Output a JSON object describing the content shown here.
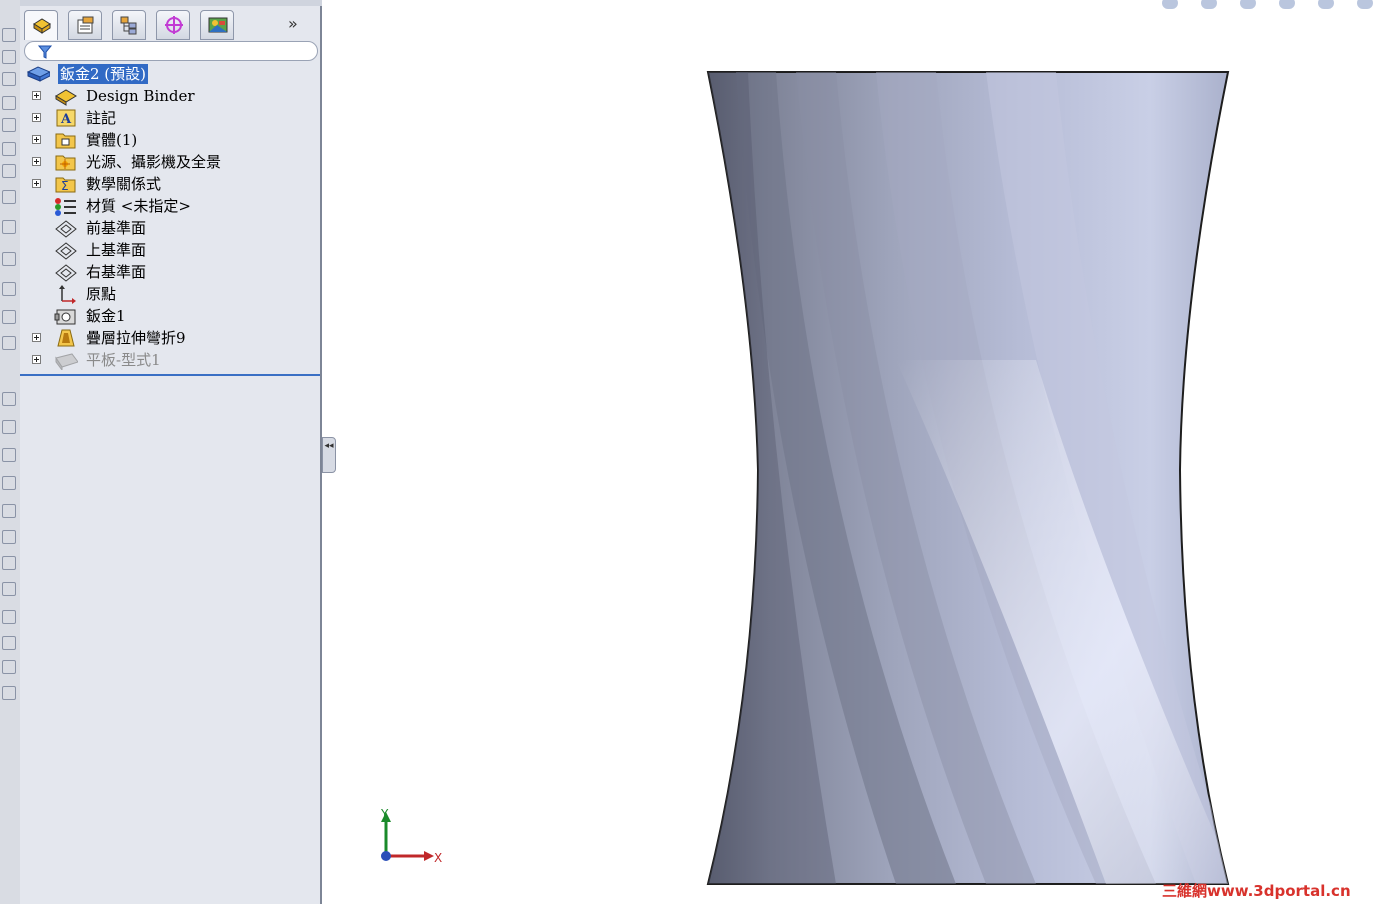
{
  "feature_tree": {
    "root_label": "鈑金2 (預設)",
    "items": [
      {
        "label": "Design Binder",
        "icon": "design-binder-icon",
        "expandable": true,
        "dim": false
      },
      {
        "label": "註記",
        "icon": "annotations-icon",
        "expandable": true,
        "dim": false
      },
      {
        "label": "實體(1)",
        "icon": "solid-bodies-icon",
        "expandable": true,
        "dim": false
      },
      {
        "label": "光源、攝影機及全景",
        "icon": "lights-cameras-icon",
        "expandable": true,
        "dim": false
      },
      {
        "label": "數學關係式",
        "icon": "equations-icon",
        "expandable": true,
        "dim": false
      },
      {
        "label": "材質 <未指定>",
        "icon": "material-icon",
        "expandable": false,
        "dim": false
      },
      {
        "label": "前基準面",
        "icon": "plane-icon",
        "expandable": false,
        "dim": false
      },
      {
        "label": "上基準面",
        "icon": "plane-icon",
        "expandable": false,
        "dim": false
      },
      {
        "label": "右基準面",
        "icon": "plane-icon",
        "expandable": false,
        "dim": false
      },
      {
        "label": "原點",
        "icon": "origin-icon",
        "expandable": false,
        "dim": false
      },
      {
        "label": "鈑金1",
        "icon": "sheet-metal-icon",
        "expandable": false,
        "dim": false
      },
      {
        "label": "疊層拉伸彎折9",
        "icon": "lofted-bend-icon",
        "expandable": true,
        "dim": false
      },
      {
        "label": "平板-型式1",
        "icon": "flat-pattern-icon",
        "expandable": true,
        "dim": true
      }
    ]
  },
  "panel_tabs": [
    {
      "name": "feature-manager-tab",
      "icon": "feature-manager-icon",
      "active": true
    },
    {
      "name": "property-manager-tab",
      "icon": "property-manager-icon",
      "active": false
    },
    {
      "name": "configuration-manager-tab",
      "icon": "configuration-manager-icon",
      "active": false
    },
    {
      "name": "dimxpert-manager-tab",
      "icon": "dimxpert-icon",
      "active": false
    },
    {
      "name": "display-manager-tab",
      "icon": "display-manager-icon",
      "active": false
    }
  ],
  "more_tabs_label": "»",
  "splitter_label": "◂◂",
  "triad": {
    "x_label": "X",
    "y_label": "Y"
  },
  "watermark": "三維網www.3dportal.cn",
  "colors": {
    "selection": "#316ac5",
    "model_light": "#c9cfe6",
    "model_dark": "#5d6274",
    "watermark": "#d8322c"
  }
}
